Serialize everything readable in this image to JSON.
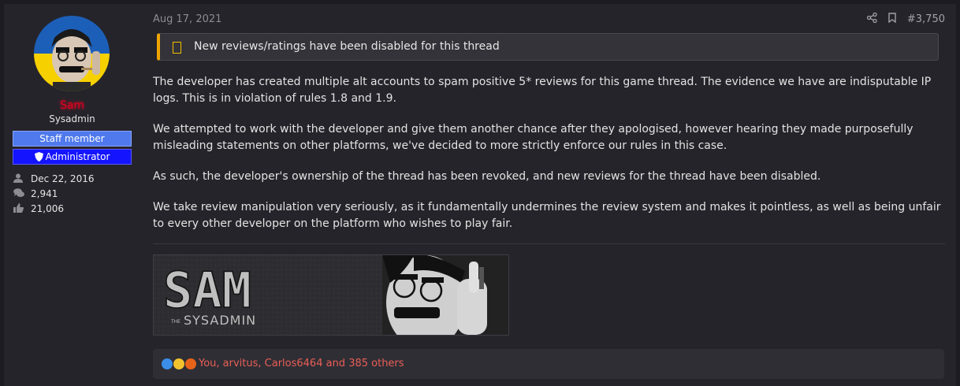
{
  "post": {
    "date": "Aug 17, 2021",
    "number": "#3,750",
    "notice": "New reviews/ratings have been disabled for this thread",
    "paragraphs": [
      "The developer has created multiple alt accounts to spam positive 5* reviews for this game thread. The evidence we have are indisputable IP logs. This is in violation of rules 1.8 and 1.9.",
      "We attempted to work with the developer and give them another chance after they apologised, however hearing they made purposefully misleading statements on other platforms, we've decided to more strictly enforce our rules in this case.",
      "As such, the developer's ownership of the thread has been revoked, and new reviews for the thread have been disabled.",
      "We take review manipulation very seriously, as it fundamentally undermines the review system and makes it pointless, as well as being unfair to every other developer on the platform who wishes to play fair."
    ],
    "reactions_text": "You, arvitus, Carlos6464 and 385 others",
    "icons": {
      "share": "share-icon",
      "bookmark": "bookmark-icon",
      "notice": "warning-icon"
    }
  },
  "user": {
    "name": "Sam",
    "title": "Sysadmin",
    "banners": [
      "Staff member",
      "Administrator"
    ],
    "stats": [
      {
        "icon": "user-icon",
        "value": "Dec 22, 2016"
      },
      {
        "icon": "messages-icon",
        "value": "2,941"
      },
      {
        "icon": "thumbs-up-icon",
        "value": "21,006"
      }
    ]
  },
  "signature": {
    "line1": "SAM",
    "line2_small": "THE",
    "line2": "SYSADMIN"
  },
  "colors": {
    "username": "#e0001f",
    "notice_accent": "#f0a500",
    "reactions": "#ea5f56",
    "staff_banner": "#4f79ec",
    "admin_banner": "#1414ff"
  }
}
